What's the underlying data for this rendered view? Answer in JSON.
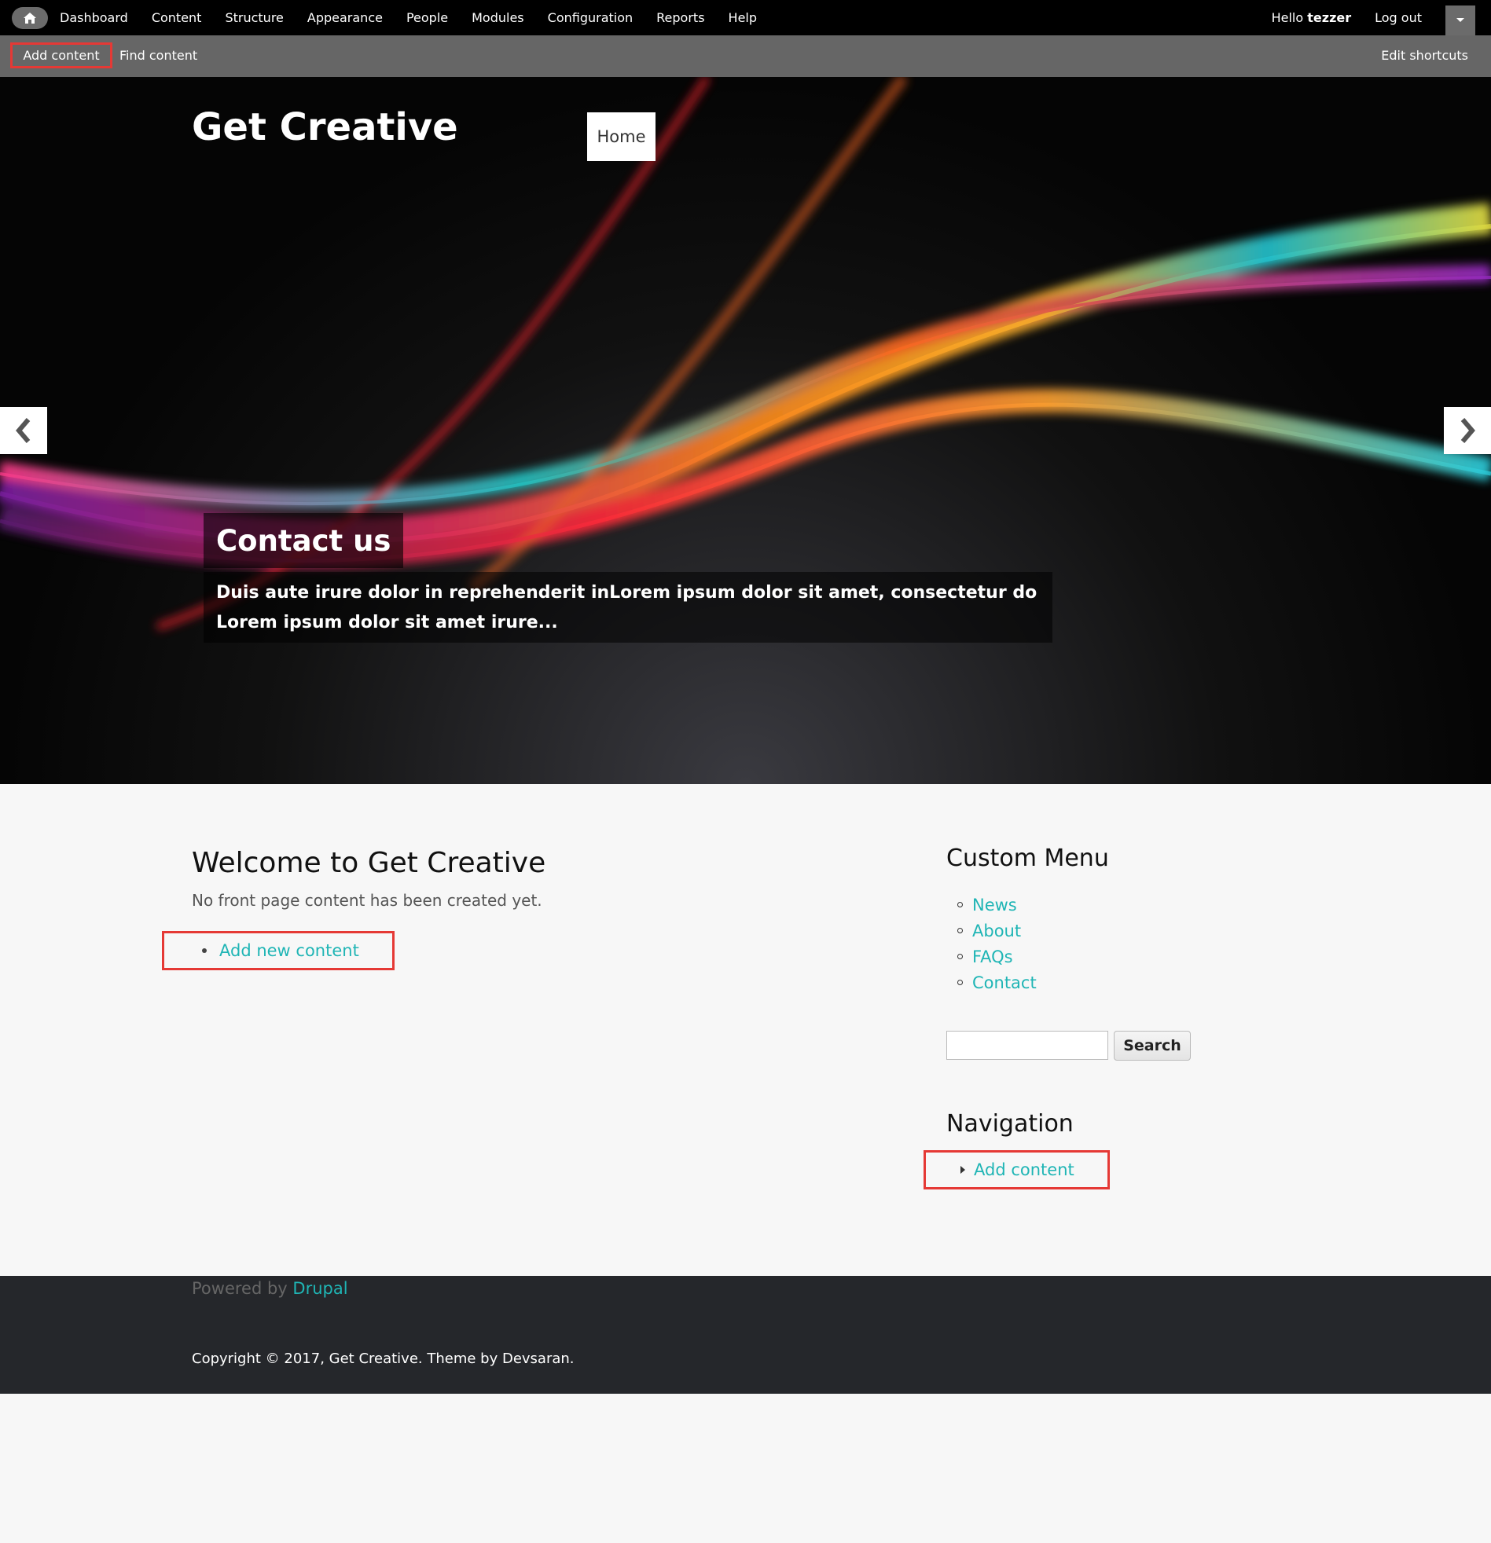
{
  "admin_toolbar": {
    "menu": [
      "Dashboard",
      "Content",
      "Structure",
      "Appearance",
      "People",
      "Modules",
      "Configuration",
      "Reports",
      "Help"
    ],
    "hello_prefix": "Hello",
    "username": "tezzer",
    "logout": "Log out"
  },
  "shortcuts": {
    "add_content": "Add content",
    "find_content": "Find content",
    "edit_shortcuts": "Edit shortcuts"
  },
  "site": {
    "name": "Get Creative",
    "main_menu": [
      "Home"
    ]
  },
  "slider": {
    "caption_title": "Contact us",
    "caption_text": "Duis aute irure dolor in reprehenderit inLorem ipsum dolor sit amet, consectetur do Lorem ipsum dolor sit amet irure..."
  },
  "main": {
    "title": "Welcome to Get Creative",
    "subtitle": "No front page content has been created yet.",
    "link": "Add new content"
  },
  "sidebar": {
    "custom_menu_title": "Custom Menu",
    "custom_menu_items": [
      "News",
      "About",
      "FAQs",
      "Contact"
    ],
    "search_button": "Search",
    "navigation_title": "Navigation",
    "navigation_items": [
      "Add content"
    ]
  },
  "footer": {
    "powered_prefix": "Powered by",
    "powered_link": "Drupal",
    "copyright": "Copyright © 2017, Get Creative. Theme by Devsaran."
  },
  "colors": {
    "link": "#1fb5b5",
    "highlight": "#e53935",
    "admin_bar": "#000000",
    "shortcut_bar": "#666666",
    "footer": "#25272b"
  }
}
